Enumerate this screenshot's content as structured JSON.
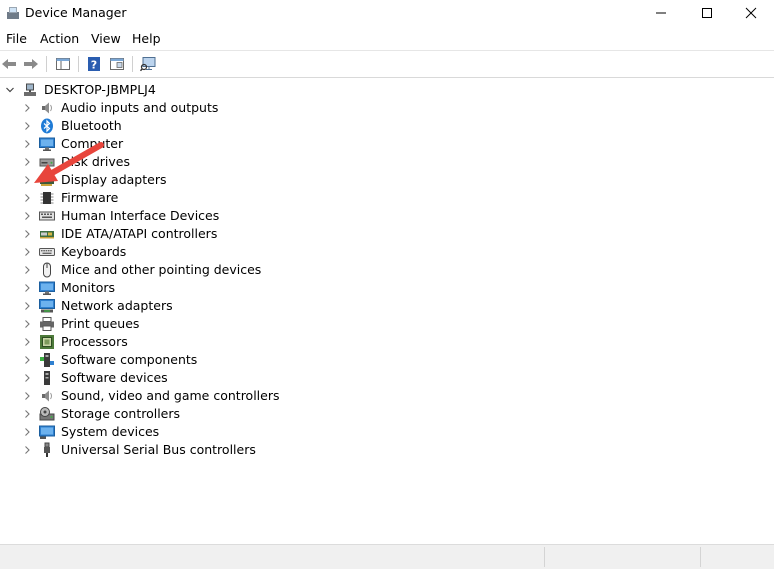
{
  "window": {
    "title": "Device Manager",
    "app_icon": "device-manager-icon"
  },
  "menu": [
    "File",
    "Action",
    "View",
    "Help"
  ],
  "toolbar": {
    "buttons": [
      "back-arrow-icon",
      "forward-arrow-icon",
      "show-hide-console-tree-icon",
      "help-icon",
      "properties-icon",
      "scan-hardware-icon"
    ]
  },
  "tree": {
    "root": "DESKTOP-JBMPLJ4",
    "items": [
      {
        "label": "Audio inputs and outputs",
        "icon": "speaker-icon"
      },
      {
        "label": "Bluetooth",
        "icon": "bluetooth-icon"
      },
      {
        "label": "Computer",
        "icon": "computer-icon"
      },
      {
        "label": "Disk drives",
        "icon": "disk-drive-icon"
      },
      {
        "label": "Display adapters",
        "icon": "display-adapter-icon"
      },
      {
        "label": "Firmware",
        "icon": "firmware-chip-icon"
      },
      {
        "label": "Human Interface Devices",
        "icon": "hid-keyboard-icon"
      },
      {
        "label": "IDE ATA/ATAPI controllers",
        "icon": "ide-controller-icon"
      },
      {
        "label": "Keyboards",
        "icon": "keyboard-icon"
      },
      {
        "label": "Mice and other pointing devices",
        "icon": "mouse-icon"
      },
      {
        "label": "Monitors",
        "icon": "monitor-icon"
      },
      {
        "label": "Network adapters",
        "icon": "network-adapter-icon"
      },
      {
        "label": "Print queues",
        "icon": "printer-icon"
      },
      {
        "label": "Processors",
        "icon": "processor-icon"
      },
      {
        "label": "Software components",
        "icon": "software-component-icon"
      },
      {
        "label": "Software devices",
        "icon": "software-device-icon"
      },
      {
        "label": "Sound, video and game controllers",
        "icon": "sound-controller-icon"
      },
      {
        "label": "Storage controllers",
        "icon": "storage-controller-icon"
      },
      {
        "label": "System devices",
        "icon": "system-devices-icon"
      },
      {
        "label": "Universal Serial Bus controllers",
        "icon": "usb-icon"
      }
    ]
  },
  "colors": {
    "annotation_arrow": "#e8453c",
    "accent_blue": "#1f7bd6"
  }
}
